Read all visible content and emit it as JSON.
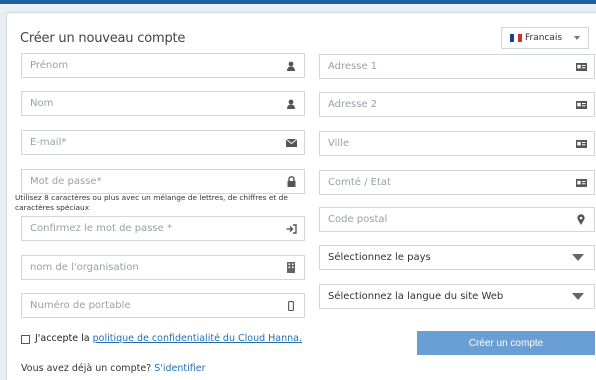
{
  "form": {
    "title": "Créer un nouveau compte",
    "language": "Francais",
    "fields_left": [
      {
        "placeholder": "Prénom",
        "icon": "user-icon"
      },
      {
        "placeholder": "Nom",
        "icon": "user-icon"
      },
      {
        "placeholder": "E-mail*",
        "icon": "envelope-icon"
      },
      {
        "placeholder": "Mot de passe*",
        "icon": "lock-icon"
      },
      {
        "placeholder": "Confirmez le mot de passe *",
        "icon": "sign-in-icon"
      },
      {
        "placeholder": "nom de l'organisation",
        "icon": "building-icon"
      },
      {
        "placeholder": "Numéro de portable",
        "icon": "mobile-icon"
      }
    ],
    "password_hint": "Utilisez 8 caractères ou plus avec un mélange de lettres, de chiffres et de caractères spéciaux",
    "fields_right": [
      {
        "placeholder": "Adresse 1",
        "icon": "id-card-icon"
      },
      {
        "placeholder": "Adresse 2",
        "icon": "id-card-icon"
      },
      {
        "placeholder": "Ville",
        "icon": "id-card-icon"
      },
      {
        "placeholder": "Comté / État",
        "icon": "id-card-icon"
      },
      {
        "placeholder": "Code postal",
        "icon": "map-marker-icon"
      }
    ],
    "country_select": "Sélectionnez le pays",
    "site_language_select": "Sélectionnez la langue du site Web",
    "accept_prefix": "J'accepte la",
    "privacy_link": "politique de confidentialité du Cloud Hanna.",
    "submit_label": "Créer un compte",
    "have_account": "Vous avez déjà un compte?",
    "login_link": "S'identifier"
  },
  "colors": {
    "accent": "#1f6fb5",
    "button": "#6a9fd4",
    "top_bar": "#1f5fa0"
  }
}
